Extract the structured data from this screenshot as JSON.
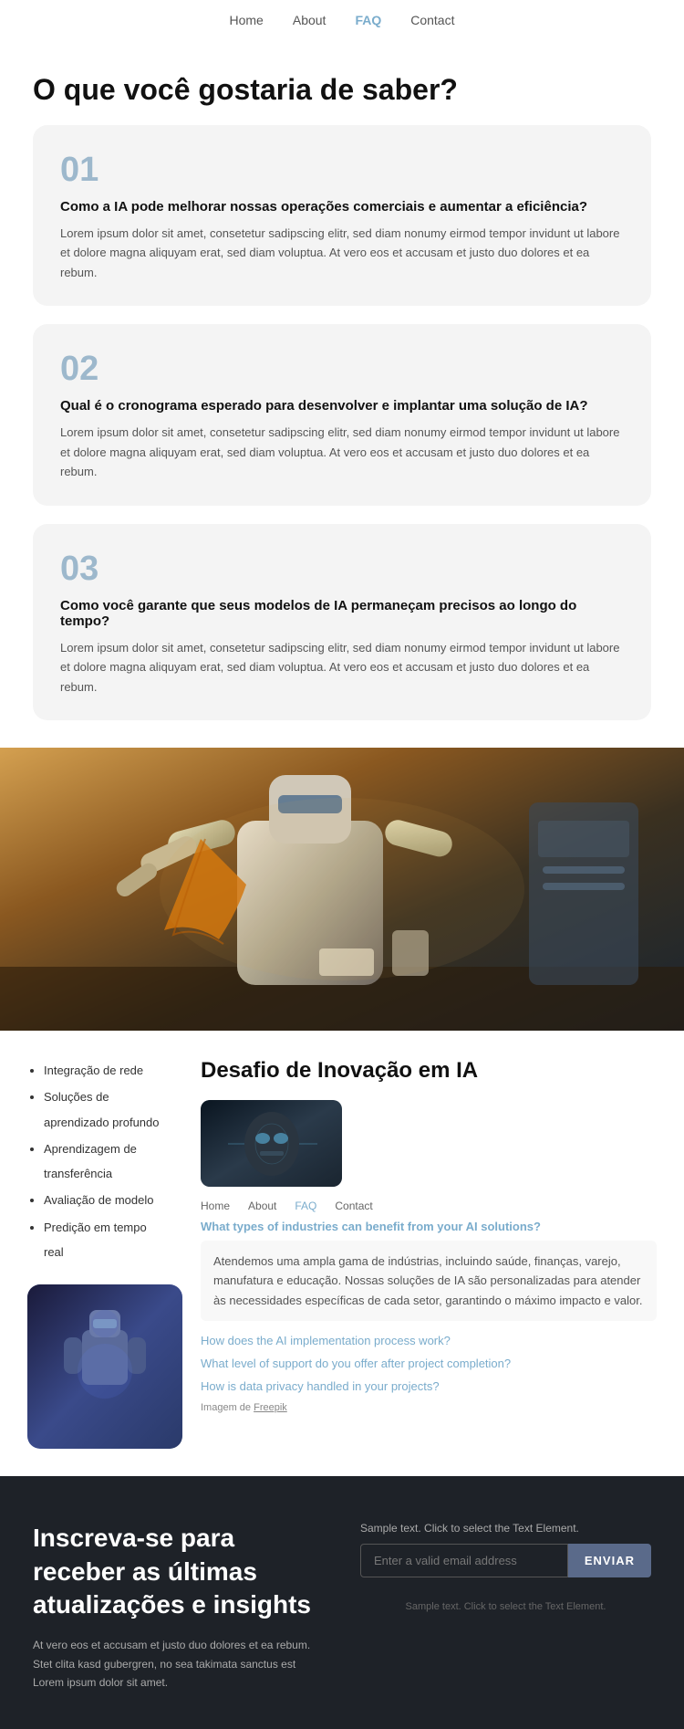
{
  "nav": {
    "items": [
      {
        "label": "Home",
        "active": false
      },
      {
        "label": "About",
        "active": false
      },
      {
        "label": "FAQ",
        "active": true
      },
      {
        "label": "Contact",
        "active": false
      }
    ]
  },
  "faq_hero": {
    "title": "O que você gostaria de saber?"
  },
  "faq_items": [
    {
      "number": "01",
      "question": "Como a IA pode melhorar nossas operações comerciais e aumentar a eficiência?",
      "answer": "Lorem ipsum dolor sit amet, consetetur sadipscing elitr, sed diam nonumy eirmod tempor invidunt ut labore et dolore magna aliquyam erat, sed diam voluptua. At vero eos et accusam et justo duo dolores et ea rebum."
    },
    {
      "number": "02",
      "question": "Qual é o cronograma esperado para desenvolver e implantar uma solução de IA?",
      "answer": "Lorem ipsum dolor sit amet, consetetur sadipscing elitr, sed diam nonumy eirmod tempor invidunt ut labore et dolore magna aliquyam erat, sed diam voluptua. At vero eos et accusam et justo duo dolores et ea rebum."
    },
    {
      "number": "03",
      "question": "Como você garante que seus modelos de IA permaneçam precisos ao longo do tempo?",
      "answer": "Lorem ipsum dolor sit amet, consetetur sadipscing elitr, sed diam nonumy eirmod tempor invidunt ut labore et dolore magna aliquyam erat, sed diam voluptua. At vero eos et accusam et justo duo dolores et ea rebum."
    }
  ],
  "innovation": {
    "title": "Desafio de Inovação em IA",
    "bullets": [
      "Integração de rede",
      "Soluções de aprendizado profundo",
      "Aprendizagem de transferência",
      "Avaliação de modelo",
      "Predição em tempo real"
    ],
    "mini_nav": [
      "Home",
      "About",
      "FAQ",
      "Contact"
    ],
    "open_faq": {
      "question": "What types of industries can benefit from your AI solutions?",
      "answer": "Atendemos uma ampla gama de indústrias, incluindo saúde, finanças, varejo, manufatura e educação. Nossas soluções de IA são personalizadas para atender às necessidades específicas de cada setor, garantindo o máximo impacto e valor."
    },
    "closed_faqs": [
      "How does the AI implementation process work?",
      "What level of support do you offer after project completion?",
      "How is data privacy handled in your projects?"
    ],
    "image_credit": "Imagem de",
    "image_credit_link": "Freepik"
  },
  "newsletter": {
    "title": "Inscreva-se para receber as últimas atualizações e insights",
    "body": "At vero eos et accusam et justo duo dolores et ea rebum. Stet clita kasd gubergren, no sea takimata sanctus est Lorem ipsum dolor sit amet.",
    "sample_text_top": "Sample text. Click to select the Text Element.",
    "email_placeholder": "Enter a valid email address",
    "button_label": "ENVIAR",
    "sample_text_bottom": "Sample text. Click to select the Text Element."
  }
}
